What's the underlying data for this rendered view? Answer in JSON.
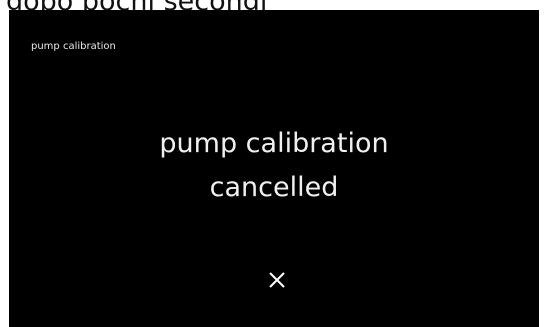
{
  "caption": "dopo pochi secondi",
  "screen": {
    "title": "pump calibration",
    "message_line1": "pump calibration",
    "message_line2": "cancelled",
    "close_icon": "close-icon"
  },
  "colors": {
    "screen_background": "#000000",
    "text": "#ffffff"
  }
}
